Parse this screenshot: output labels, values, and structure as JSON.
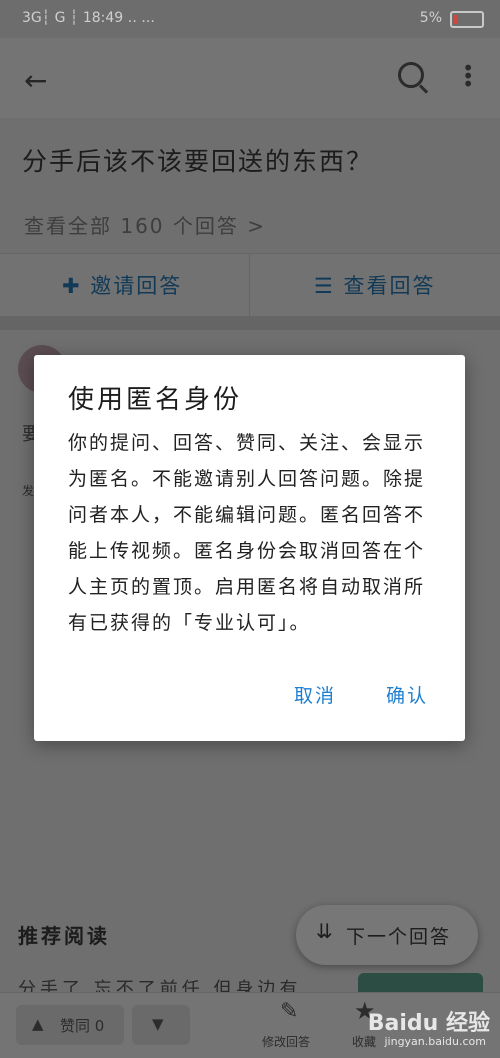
{
  "status": {
    "left": "3G┆ G ┆ 18:49 ․․ ...",
    "battery": "5%"
  },
  "question": {
    "title": "分手后该不该要回送的东西？",
    "meta": "查看全部 160 个回答 >"
  },
  "actions": {
    "invite": "邀请回答",
    "view": "查看回答"
  },
  "fragments": {
    "a": "要",
    "b": "发"
  },
  "dialog": {
    "title": "使用匿名身份",
    "body": "你的提问、回答、赞同、关注、会显示为匿名。不能邀请别人回答问题。除提问者本人，不能编辑问题。匿名回答不能上传视频。匿名身份会取消回答在个人主页的置顶。启用匿名将自动取消所有已获得的「专业认可」。",
    "cancel": "取消",
    "confirm": "确认"
  },
  "recommend": {
    "heading": "推荐阅读",
    "line": "分手了  忘不了前任  但身边有",
    "next": "下一个回答"
  },
  "bottom": {
    "like": "赞同 0",
    "edit": "修改回答",
    "collect": "收藏"
  },
  "watermark": {
    "brand": "Baidu 经验",
    "site": "jingyan.baidu.com"
  }
}
